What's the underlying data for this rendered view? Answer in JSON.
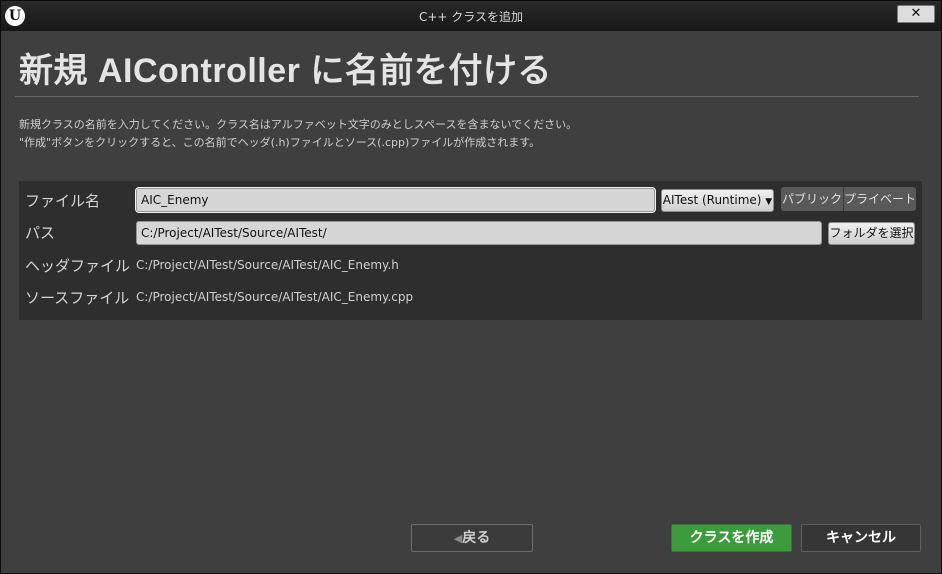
{
  "window": {
    "title": "C++ クラスを追加",
    "logo": "U",
    "close_glyph": "✕"
  },
  "heading": "新規 AIController に名前を付ける",
  "description": [
    "新規クラスの名前を入力してください。クラス名はアルファベット文字のみとしスペースを含まないでください。",
    "\"作成\"ボタンをクリックすると、この名前でヘッダ(.h)ファイルとソース(.cpp)ファイルが作成されます。"
  ],
  "form": {
    "name_label": "ファイル名",
    "name_value": "AIC_Enemy",
    "module_dropdown": "AITest (Runtime)",
    "visibility_options": [
      "パブリック",
      "プライベート"
    ],
    "path_label": "パス",
    "path_value": "C:/Project/AITest/Source/AITest/",
    "choose_folder_button": "フォルダを選択",
    "header_label": "ヘッダファイル",
    "header_value": "C:/Project/AITest/Source/AITest/AIC_Enemy.h",
    "source_label": "ソースファイル",
    "source_value": "C:/Project/AITest/Source/AITest/AIC_Enemy.cpp"
  },
  "footer": {
    "back_label": "戻る",
    "back_icon": "chevron-left-icon",
    "create_label": "クラスを作成",
    "cancel_label": "キャンセル"
  },
  "colors": {
    "create_button": "#3d9b3d",
    "window_background": "#3f3f3f",
    "panel_background": "#2e2e2e"
  }
}
